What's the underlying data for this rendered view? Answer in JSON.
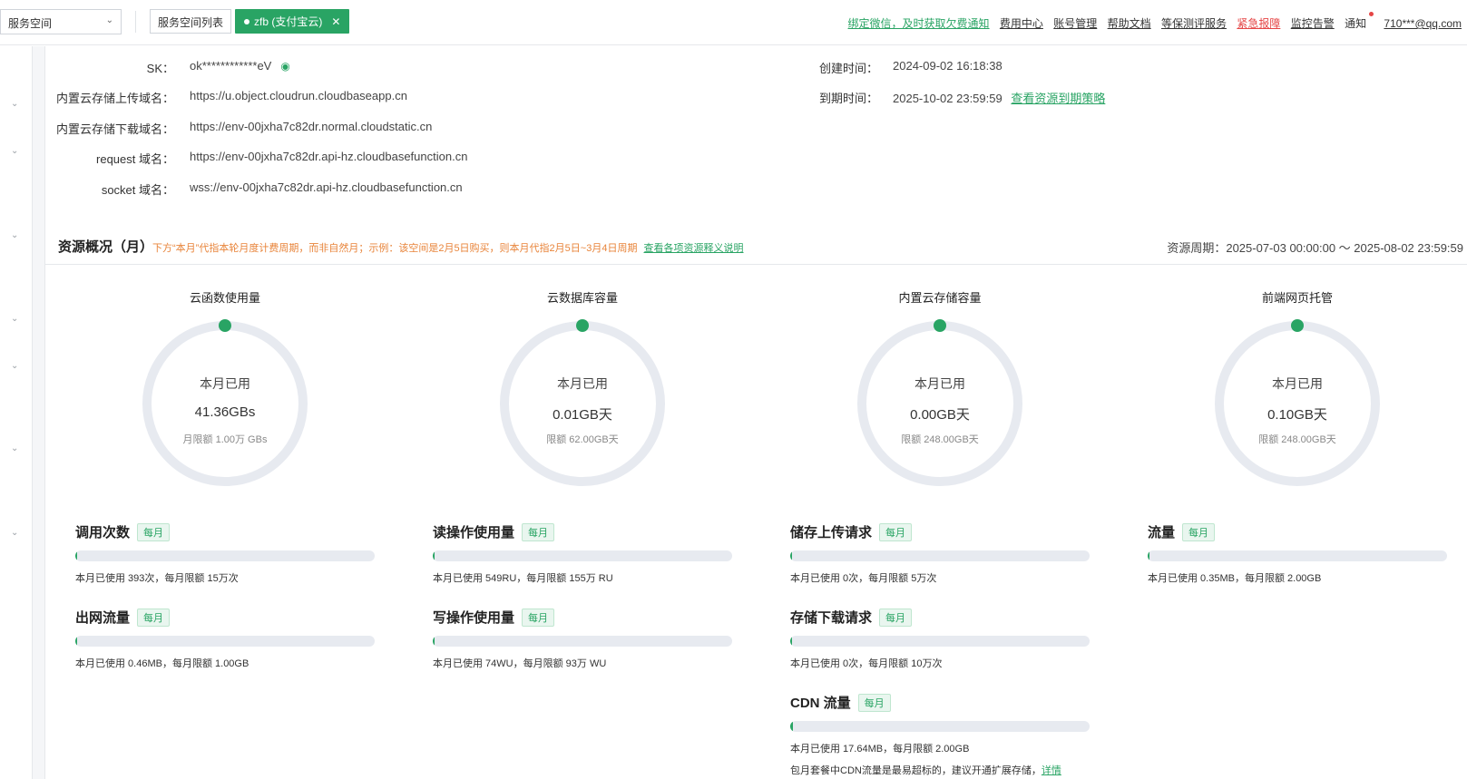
{
  "topbar": {
    "space_select": "服务空间",
    "space_list": "服务空间列表",
    "env_tag": "zfb (支付宝云)",
    "links": {
      "bind_wechat": "绑定微信，及时获取欠费通知",
      "billing": "费用中心",
      "account": "账号管理",
      "docs": "帮助文档",
      "security": "等保测评服务",
      "report": "紧急报障",
      "monitor": "监控告警",
      "notice": "通知",
      "user": "710***@qq.com"
    }
  },
  "info": {
    "sk_label": "SK：",
    "sk_value": "ok************eV",
    "upload_label": "内置云存储上传域名：",
    "upload_value": "https://u.object.cloudrun.cloudbaseapp.cn",
    "download_label": "内置云存储下载域名：",
    "download_value": "https://env-00jxha7c82dr.normal.cloudstatic.cn",
    "request_label": "request 域名：",
    "request_value": "https://env-00jxha7c82dr.api-hz.cloudbasefunction.cn",
    "socket_label": "socket 域名：",
    "socket_value": "wss://env-00jxha7c82dr.api-hz.cloudbasefunction.cn",
    "created_label": "创建时间：",
    "created_value": "2024-09-02 16:18:38",
    "expire_label": "到期时间：",
    "expire_value": "2025-10-02 23:59:59",
    "expire_link": "查看资源到期策略"
  },
  "overview": {
    "title": "资源概况（月）",
    "note": "下方“本月”代指本轮月度计费周期，而非自然月；示例：该空间是2月5日购买，则本月代指2月5日~3月4日周期",
    "note_link": "查看各项资源释义说明",
    "period": "资源周期：2025-07-03 00:00:00 ～ 2025-08-02 23:59:59"
  },
  "gauges": [
    {
      "title": "云函数使用量",
      "label": "本月已用",
      "value": "41.36GBs",
      "limit": "月限额 1.00万 GBs",
      "fraction": 0.004
    },
    {
      "title": "云数据库容量",
      "label": "本月已用",
      "value": "0.01GB天",
      "limit": "限额 62.00GB天",
      "fraction": 0.0002
    },
    {
      "title": "内置云存储容量",
      "label": "本月已用",
      "value": "0.00GB天",
      "limit": "限额 248.00GB天",
      "fraction": 0.0
    },
    {
      "title": "前端网页托管",
      "label": "本月已用",
      "value": "0.10GB天",
      "limit": "限额 248.00GB天",
      "fraction": 0.0004
    }
  ],
  "metrics": [
    {
      "title": "调用次数",
      "badge": "每月",
      "desc": "本月已使用 393次，每月限额 15万次",
      "fraction": 0.003
    },
    {
      "title": "出网流量",
      "badge": "每月",
      "desc": "本月已使用 0.46MB，每月限额 1.00GB",
      "fraction": 0.0005
    },
    {
      "title": "读操作使用量",
      "badge": "每月",
      "desc": "本月已使用 549RU，每月限额 155万 RU",
      "fraction": 0.0004
    },
    {
      "title": "写操作使用量",
      "badge": "每月",
      "desc": "本月已使用 74WU，每月限额 93万 WU",
      "fraction": 0.0001
    },
    {
      "title": "储存上传请求",
      "badge": "每月",
      "desc": "本月已使用 0次，每月限额 5万次",
      "fraction": 0.0
    },
    {
      "title": "存储下载请求",
      "badge": "每月",
      "desc": "本月已使用 0次，每月限额 10万次",
      "fraction": 0.0
    },
    {
      "title": "CDN 流量",
      "badge": "每月",
      "desc": "本月已使用 17.64MB，每月限额 2.00GB",
      "fraction": 0.0086,
      "extra": "包月套餐中CDN流量是最易超标的，建议开通扩展存储，",
      "extra_link": "详情"
    },
    {
      "title": "流量",
      "badge": "每月",
      "desc": "本月已使用 0.35MB，每月限额 2.00GB",
      "fraction": 0.0002
    }
  ],
  "colors": {
    "accent": "#29a464",
    "warning": "#e8843a",
    "danger": "#e54545",
    "track": "#e7eaf0"
  }
}
